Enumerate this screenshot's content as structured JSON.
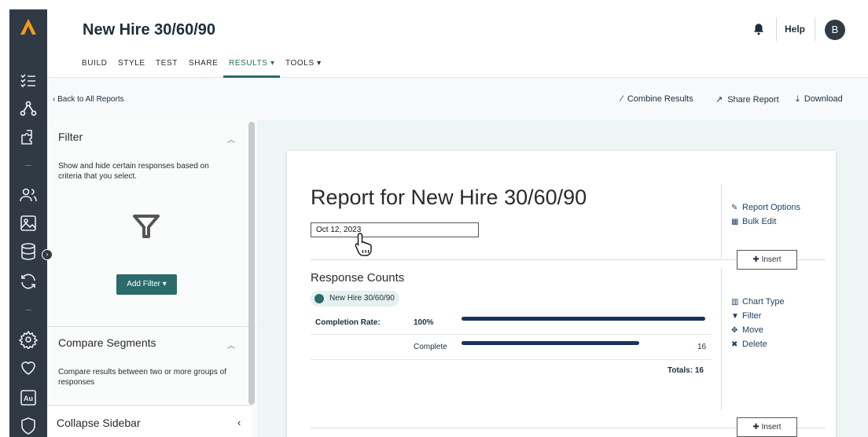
{
  "header": {
    "title": "New Hire 30/60/90",
    "help_label": "Help",
    "avatar_initial": "B"
  },
  "nav": {
    "tabs": [
      {
        "label": "BUILD"
      },
      {
        "label": "STYLE"
      },
      {
        "label": "TEST"
      },
      {
        "label": "SHARE"
      },
      {
        "label": "RESULTS ▾"
      },
      {
        "label": "TOOLS ▾"
      }
    ],
    "active_tab": "RESULTS"
  },
  "subbar": {
    "back_label": "‹ Back to All Reports",
    "combine_label": "Combine Results",
    "share_label": "Share Report",
    "download_label": "Download"
  },
  "sidebar": {
    "filter": {
      "title": "Filter",
      "description": "Show and hide certain responses based on criteria that you select.",
      "add_filter_label": "Add Filter ▾"
    },
    "compare": {
      "title": "Compare Segments",
      "description": "Compare results between two or more groups of responses"
    },
    "collapse_label": "Collapse Sidebar"
  },
  "report": {
    "title": "Report for New Hire 30/60/90",
    "date_value": "Oct 12, 2023",
    "options": {
      "report_options_label": "Report Options",
      "bulk_edit_label": "Bulk Edit"
    },
    "insert_label": "Insert",
    "section": {
      "title": "Response Counts",
      "survey_pill": "New Hire 30/60/90",
      "completion_label": "Completion Rate:",
      "completion_value": "100%",
      "completion_fraction": 1.0,
      "rows": [
        {
          "label": "Complete",
          "count": "16",
          "fraction": 0.73
        }
      ],
      "totals_label": "Totals: 16"
    },
    "chart_actions": {
      "chart_type_label": "Chart Type",
      "filter_label": "Filter",
      "move_label": "Move",
      "delete_label": "Delete"
    }
  },
  "colors": {
    "rail": "#2f3a44",
    "accent": "#2b6b6b",
    "logo": "#f59a1b",
    "bar": "#17355c",
    "main_bg": "#eef6f5"
  },
  "icons": [
    "logo-icon",
    "checklist-icon",
    "network-icon",
    "puzzle-icon",
    "users-icon",
    "image-icon",
    "database-icon",
    "sync-icon",
    "gear-icon",
    "heart-icon",
    "au-icon",
    "shield-icon",
    "bell-icon",
    "wand-icon",
    "share-icon",
    "download-icon",
    "funnel-icon",
    "pencil-icon",
    "table-icon",
    "bar-chart-icon",
    "filter-icon",
    "move-icon",
    "delete-icon",
    "pointer-hand-icon"
  ]
}
